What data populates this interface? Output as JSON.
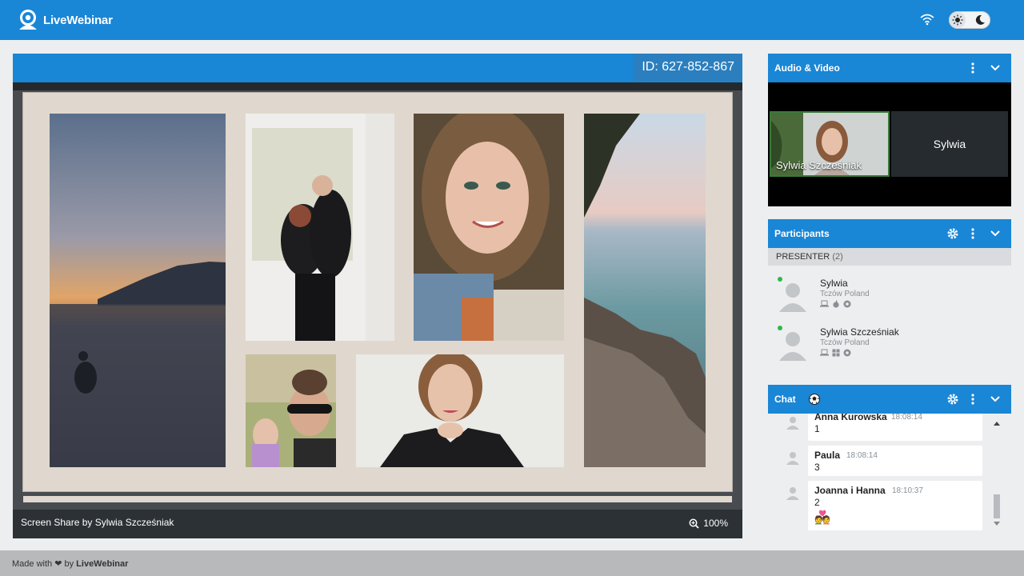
{
  "brand": {
    "name": "LiveWebinar"
  },
  "stage": {
    "id_label": "ID: 627-852-867",
    "share_label": "Screen Share by Sylwia Szcześniak",
    "zoom": "100%"
  },
  "audio_video": {
    "title": "Audio & Video",
    "tiles": [
      {
        "name": "Sylwia Szcześniak"
      },
      {
        "name": "Sylwia"
      }
    ]
  },
  "participants": {
    "title": "Participants",
    "group_label": "PRESENTER",
    "group_count": "(2)",
    "items": [
      {
        "name": "Sylwia",
        "location": "Tczów Poland"
      },
      {
        "name": "Sylwia Szcześniak",
        "location": "Tczów Poland"
      }
    ]
  },
  "chat": {
    "title": "Chat",
    "messages": [
      {
        "author": "Anna Kurowska",
        "time": "18:08:14",
        "text": "1"
      },
      {
        "author": "Paula",
        "time": "18:08:14",
        "text": "3"
      },
      {
        "author": "Joanna i Hanna",
        "time": "18:10:37",
        "text": "2",
        "emoji": "💑"
      }
    ]
  },
  "footer": {
    "made_with": "Made with",
    "by": "by",
    "brand": "LiveWebinar"
  },
  "colors": {
    "primary": "#1a86d6",
    "online": "#2fb84a"
  }
}
